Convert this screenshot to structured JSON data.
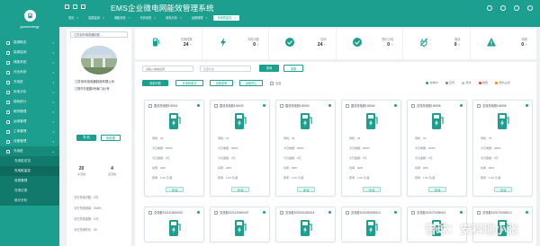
{
  "sidebar": {
    "brand": "guoeenergy",
    "items": [
      {
        "label": "能源概览",
        "open": false
      },
      {
        "label": "能源监测",
        "open": false
      },
      {
        "label": "储能系统",
        "open": false
      },
      {
        "label": "光伏系统",
        "open": false
      },
      {
        "label": "充电桩",
        "open": false
      },
      {
        "label": "用电分析",
        "open": false
      },
      {
        "label": "能耗统计",
        "open": false
      },
      {
        "label": "碳排管理",
        "open": false
      },
      {
        "label": "运维管理",
        "open": false
      },
      {
        "label": "工单管理",
        "open": false
      },
      {
        "label": "设备管理",
        "open": false
      },
      {
        "label": "充电桩",
        "open": true
      }
    ],
    "subitems": [
      {
        "label": "充电桩总览",
        "active": false
      },
      {
        "label": "充电桩监控",
        "active": true
      },
      {
        "label": "收费管理",
        "active": false
      },
      {
        "label": "充电记录",
        "active": false
      },
      {
        "label": "统计分析",
        "active": false
      }
    ]
  },
  "topbar": {
    "title": "EMS企业微电网能效管理系统",
    "tabs": [
      {
        "label": "首页",
        "active": false
      },
      {
        "label": "能源监测",
        "active": false
      },
      {
        "label": "储能系统",
        "active": false
      },
      {
        "label": "光伏系统",
        "active": false
      },
      {
        "label": "用电分析",
        "active": false
      },
      {
        "label": "运维管理",
        "active": false
      },
      {
        "label": "充电桩监控",
        "active": true
      }
    ]
  },
  "station": {
    "selector": "江苏安科瑞电器制造...",
    "name": "江苏安科瑞电器制造有限公司",
    "address": "江阴市东盛路5号南门北1号",
    "btn_primary": "导 航",
    "btn_ghost": "电桩图",
    "stats": [
      {
        "value": "20",
        "label": "交流桩"
      },
      {
        "value": "4",
        "label": "直流桩"
      }
    ],
    "info": [
      "今日充电次数：0次",
      "今日充电电量：0kWh",
      "今日充电金额：0元",
      "今日充电时长：0h"
    ]
  },
  "kpis": [
    {
      "icon": "charger-icon",
      "label": "充电桩数",
      "value": "24",
      "unit": "个"
    },
    {
      "icon": "bolt-icon",
      "label": "充电中数",
      "value": "0",
      "unit": "个"
    },
    {
      "icon": "check-icon",
      "label": "空闲",
      "value": "24",
      "unit": "个"
    },
    {
      "icon": "check-icon",
      "label": "预约占用",
      "value": "0",
      "unit": "个"
    },
    {
      "icon": "plug-off-icon",
      "label": "离线",
      "value": "0",
      "unit": "个"
    },
    {
      "icon": "warning-icon",
      "label": "故障",
      "value": "0",
      "unit": "个"
    }
  ],
  "filter": {
    "search_placeholder": "请输入电桩名称",
    "select_value": "全部状态",
    "query_label": "查询",
    "reset_label": "重置",
    "toggles": [
      {
        "label": "电桩列表",
        "active": true
      },
      {
        "label": "充电枪模式",
        "active": false
      },
      {
        "label": "设置费率",
        "active": false
      },
      {
        "label": "远程停止",
        "active": false
      }
    ],
    "check_all": "全选",
    "legend": [
      {
        "label": "充电中",
        "color": "#1c9f8e"
      },
      {
        "label": "空闲",
        "color": "#4caf50"
      },
      {
        "label": "离线",
        "color": "#bdbdbd"
      },
      {
        "label": "故障",
        "color": "#e53935"
      },
      {
        "label": "预约占用",
        "color": "#fb8c00"
      }
    ]
  },
  "cards": [
    {
      "title": "直流充电桩100001",
      "status": "待机：29",
      "power": "今日电量：0kWh",
      "money": "今日金额：0元",
      "time": "功率：0kW",
      "rate": "费率：1.00 元/度",
      "detail": "详 情"
    },
    {
      "title": "直流充电桩100002",
      "status": "待机：31",
      "power": "今日电量：0kWh",
      "money": "今日金额：0元",
      "time": "功率：0kW",
      "rate": "费率：1.00 元/度",
      "detail": "详 情"
    },
    {
      "title": "直流充电桩100003",
      "status": "待机：32",
      "power": "今日电量：0kWh",
      "money": "今日金额：0元",
      "time": "功率：0kW",
      "rate": "费率：1.00 元/度",
      "detail": "详 情"
    },
    {
      "title": "直流充电桩100004",
      "status": "待机：26",
      "power": "今日电量：0kWh",
      "money": "今日金额：0元",
      "time": "功率：0kW",
      "rate": "费率：1.00 元/度",
      "detail": "详 情"
    },
    {
      "title": "交流充电桩100005",
      "status": "待机：19",
      "power": "今日电量：0kWh",
      "money": "今日金额：0元",
      "time": "功率：0kW",
      "rate": "费率：1.00 元/度",
      "detail": "详 情"
    },
    {
      "title": "交流充电桩100006",
      "status": "待机：76",
      "power": "今日电量：0kWh",
      "money": "今日金额：0元",
      "time": "功率：0kW",
      "rate": "费率：1.00 元/度",
      "detail": "详 情"
    }
  ],
  "cards_row2": [
    {
      "title": "交流桩2021110000012"
    },
    {
      "title": "交流桩2021120000437"
    },
    {
      "title": "交流桩2022011000014"
    },
    {
      "title": "交流桩2021090000014"
    },
    {
      "title": "交流桩2021070000011"
    },
    {
      "title": "交流桩2021070000012"
    }
  ],
  "watermark": "雪球：安科瑞小张"
}
